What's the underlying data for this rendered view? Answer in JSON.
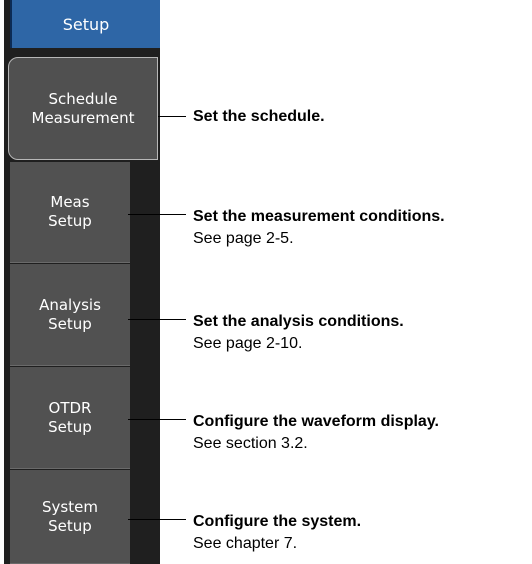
{
  "panel": {
    "header_label": "Setup",
    "items": [
      {
        "label": "Schedule\nMeasurement",
        "active": true
      },
      {
        "label": "Meas\nSetup",
        "active": false
      },
      {
        "label": "Analysis\nSetup",
        "active": false
      },
      {
        "label": "OTDR\nSetup",
        "active": false
      },
      {
        "label": "System\nSetup",
        "active": false
      }
    ]
  },
  "annotations": [
    {
      "title": "Set the schedule.",
      "ref": ""
    },
    {
      "title": "Set the measurement conditions.",
      "ref": "See page 2-5."
    },
    {
      "title": "Set the analysis conditions.",
      "ref": "See page 2-10."
    },
    {
      "title": "Configure the waveform display.",
      "ref": "See section 3.2."
    },
    {
      "title": "Configure the system.",
      "ref": "See chapter 7."
    }
  ],
  "colors": {
    "header_blue": "#2e66a6",
    "button_gray": "#515151",
    "panel_dark": "#1f1f1f"
  }
}
